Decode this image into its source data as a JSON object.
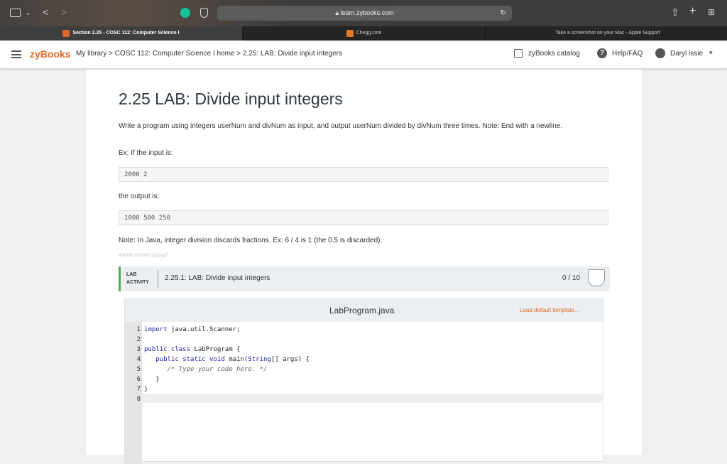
{
  "browser": {
    "url": "learn.zybooks.com",
    "tabs": [
      {
        "label": "Section 2.25 - COSC 112: Computer Science I",
        "active": true
      },
      {
        "label": "Chegg.com",
        "active": false
      },
      {
        "label": "Take a screenshot on your Mac - Apple Support",
        "active": false
      }
    ]
  },
  "header": {
    "logo": "zyBooks",
    "breadcrumb": "My library > COSC 112: Computer Science I home > 2.25: LAB: Divide input integers",
    "catalog": "zyBooks catalog",
    "help": "Help/FAQ",
    "user": "Daryl issie"
  },
  "content": {
    "title": "2.25 LAB: Divide input integers",
    "para1": "Write a program using integers userNum and divNum as input, and output userNum divided by divNum three times. Note: End with a newline.",
    "ex_label": "Ex: If the input is:",
    "input_example": "2000 2",
    "output_label": "the output is:",
    "output_example": "1000 500 250",
    "note": "Note: In Java, integer division discards fractions. Ex: 6 / 4 is 1 (the 0.5 is discarded).",
    "id_text": "431500.2302470.qx3zqy7"
  },
  "lab": {
    "tag_line1": "LAB",
    "tag_line2": "ACTIVITY",
    "title": "2.25.1: LAB: Divide input integers",
    "score": "0 / 10"
  },
  "editor": {
    "filename": "LabProgram.java",
    "load_template": "Load default template...",
    "line_numbers": [
      "1",
      "2",
      "3",
      "4",
      "5",
      "6",
      "7",
      "8"
    ]
  },
  "colors": {
    "brand": "#e0692a",
    "lab_accent": "#4caf50",
    "load_link": "#e0692a"
  }
}
